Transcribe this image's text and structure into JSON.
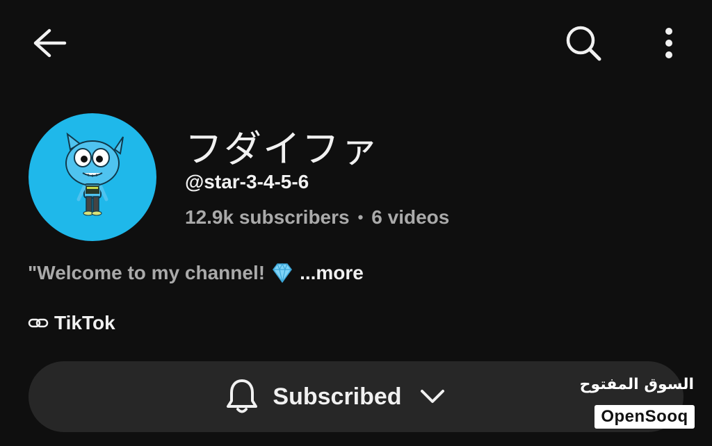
{
  "header": {
    "back_icon": "arrow-left-icon",
    "search_icon": "search-icon",
    "more_icon": "more-vertical-icon"
  },
  "channel": {
    "name": "フダイファ",
    "handle": "@star-3-4-5-6",
    "subscribers": "12.9k subscribers",
    "separator": "•",
    "videos": "6 videos",
    "avatar_bg": "#1fb8ea"
  },
  "description": {
    "text": "\"Welcome to my channel!",
    "emoji_icon": "gem-icon",
    "more_label": "...more"
  },
  "link": {
    "icon": "link-icon",
    "label": "TikTok"
  },
  "subscribe": {
    "label": "Subscribed",
    "bell_icon": "bell-icon",
    "chevron_icon": "chevron-down-icon"
  },
  "watermark": {
    "arabic": "السوق المفتوح",
    "latin": "OpenSooq"
  },
  "colors": {
    "background": "#0f0f0f",
    "primary_text": "#f1f1f1",
    "secondary_text": "#aaaaaa",
    "button_bg": "#272727"
  }
}
